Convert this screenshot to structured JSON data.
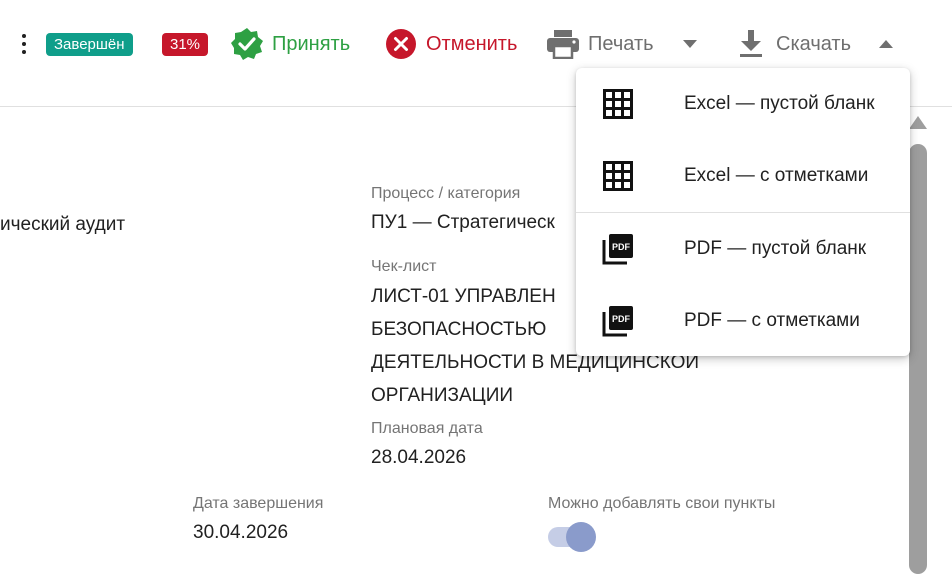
{
  "toolbar": {
    "status_badge": "Завершён",
    "percent_badge": "31%",
    "accept_label": "Принять",
    "cancel_label": "Отменить",
    "print_label": "Печать",
    "download_label": "Скачать"
  },
  "fields": {
    "left_partial_value": "ический аудит",
    "process_label": "Процесс / категория",
    "process_value": "ПУ1 — Стратегическ",
    "checklist_label": "Чек-лист",
    "checklist_lines": [
      "ЛИСТ-01 УПРАВЛЕН",
      "БЕЗОПАСНОСТЬЮ",
      "ДЕЯТЕЛЬНОСТИ В МЕДИЦИНСКОЙ",
      "ОРГАНИЗАЦИИ"
    ],
    "planned_date_label": "Плановая дата",
    "planned_date_value": "28.04.2026",
    "completion_date_label": "Дата завершения",
    "completion_date_value": "30.04.2026",
    "custom_items_label": "Можно добавлять свои пункты",
    "custom_items_enabled": true
  },
  "download_menu": {
    "items": [
      {
        "label": "Excel — пустой бланк",
        "icon": "grid-icon"
      },
      {
        "label": "Excel — с отметками",
        "icon": "grid-icon"
      },
      {
        "label": "PDF — пустой бланк",
        "icon": "pdf-icon"
      },
      {
        "label": "PDF — с отметками",
        "icon": "pdf-icon"
      }
    ]
  },
  "colors": {
    "status_badge": "#0f9e8a",
    "percent_badge": "#c6172b",
    "accept": "#2ea043",
    "cancel": "#c6172b",
    "toggle_thumb": "#8a9bcb"
  }
}
